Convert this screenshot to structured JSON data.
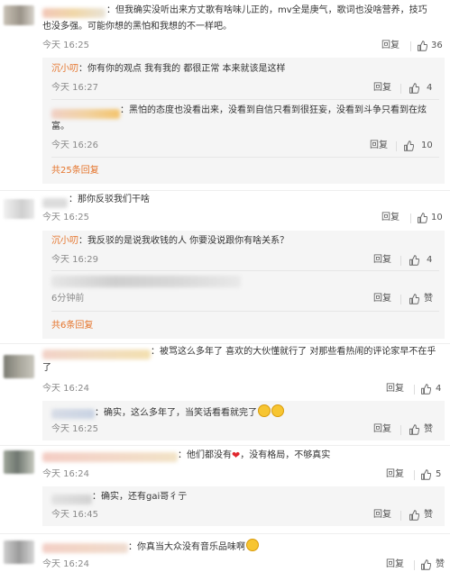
{
  "labels": {
    "reply": "回复",
    "like": "赞"
  },
  "c1": {
    "text_l1": "：但我确实没听出来方丈歌有啥味儿正的，mv全是庚气，歌词也没啥营养，技巧",
    "text_l2": "也没多强。可能你想的黑怕和我想的不一样吧。",
    "time": "今天 16:25",
    "likes": "36",
    "r1": {
      "name": "沉小叨",
      "text": "：你有你的观点 我有我的 都很正常 本来就该是这样",
      "time": "今天 16:27",
      "likes": "4"
    },
    "r2": {
      "text_l1": "：黑怕的态度也没看出来，没看到自信只看到很狂妄，没看到斗争只看到在炫",
      "text_l2": "富。",
      "time": "今天 16:26",
      "likes": "10"
    },
    "more": "共25条回复"
  },
  "c2": {
    "text": "：那你反驳我们干啥",
    "time": "今天 16:25",
    "likes": "10",
    "r1": {
      "name": "沉小叨",
      "text": "：我反驳的是说我收钱的人 你要没说跟你有啥关系？",
      "time": "今天 16:29",
      "likes": "4"
    },
    "r2": {
      "time": "6分钟前",
      "likes": "赞"
    },
    "more": "共6条回复"
  },
  "c3": {
    "text_l1": "：被骂这么多年了 喜欢的大伙懂就行了 对那些看热闹的评论家早不在乎",
    "text_l2": "了",
    "time": "今天 16:24",
    "likes": "4",
    "r1": {
      "text": "：确实，这么多年了，当笑话看看就完了",
      "time": "今天 16:25",
      "likes": "赞"
    }
  },
  "c4": {
    "text_a": "：他们都没有",
    "text_b": "，没有格局，不够真实",
    "time": "今天 16:24",
    "likes": "5",
    "r1": {
      "text": "：确实，还有gai哥彳亍",
      "time": "今天 16:45",
      "likes": "赞"
    }
  },
  "c5": {
    "text": "：你真当大众没有音乐品味啊",
    "time": "今天 16:24",
    "likes": "赞"
  },
  "colors": {
    "accent": "#e5742b",
    "reply_bg": "#f5f5f5"
  }
}
